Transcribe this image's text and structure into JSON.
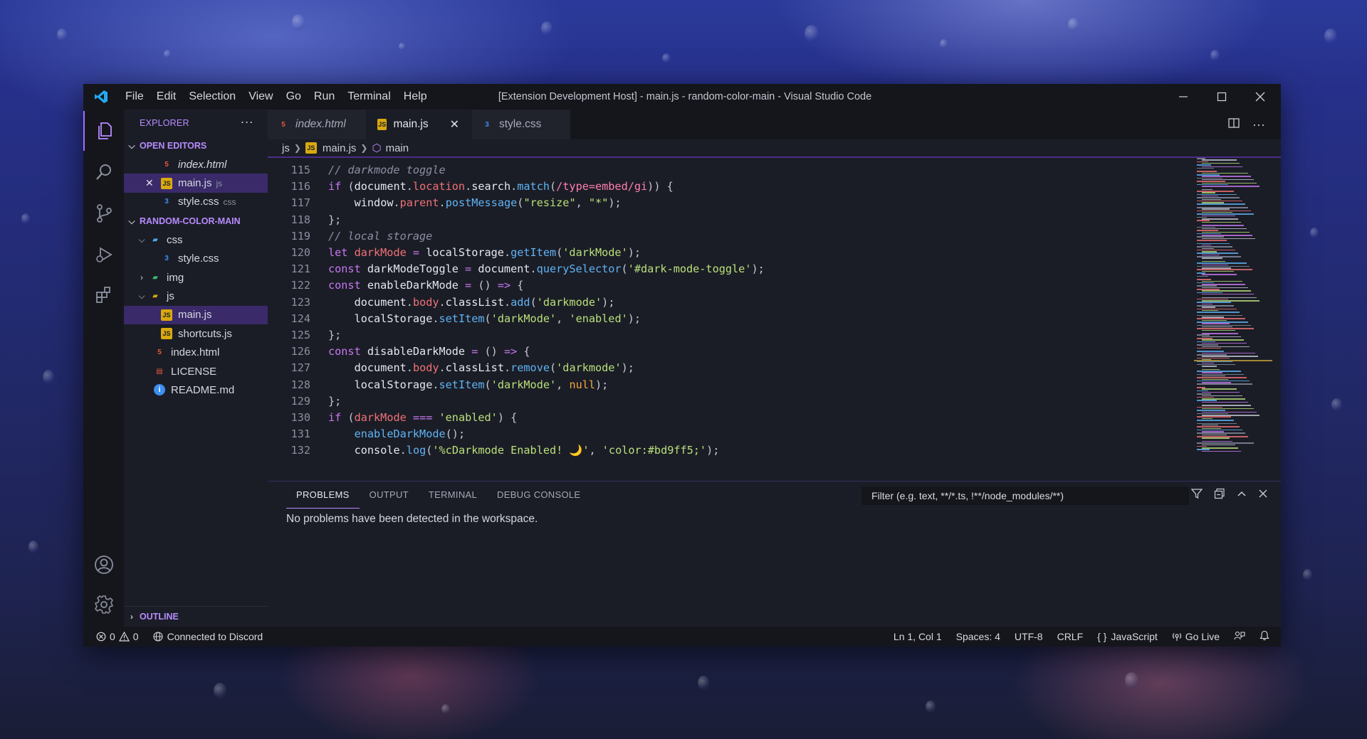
{
  "window": {
    "title": "[Extension Development Host] - main.js - random-color-main - Visual Studio Code",
    "menu": [
      "File",
      "Edit",
      "Selection",
      "View",
      "Go",
      "Run",
      "Terminal",
      "Help"
    ]
  },
  "sidebar": {
    "title": "EXPLORER",
    "open_editors_label": "OPEN EDITORS",
    "open_editors": [
      {
        "name": "index.html",
        "type": "html"
      },
      {
        "name": "main.js",
        "type": "js",
        "suffix": "js"
      },
      {
        "name": "style.css",
        "type": "css",
        "suffix": "css"
      }
    ],
    "project_label": "RANDOM-COLOR-MAIN",
    "tree": {
      "css_folder": "css",
      "style_css": "style.css",
      "img_folder": "img",
      "js_folder": "js",
      "main_js": "main.js",
      "shortcuts_js": "shortcuts.js",
      "index_html": "index.html",
      "license": "LICENSE",
      "readme": "README.md"
    },
    "outline_label": "OUTLINE"
  },
  "tabs": [
    {
      "label": "index.html",
      "type": "html"
    },
    {
      "label": "main.js",
      "type": "js"
    },
    {
      "label": "style.css",
      "type": "css"
    }
  ],
  "breadcrumb": {
    "folder": "js",
    "file": "main.js",
    "symbol": "main"
  },
  "code": {
    "lines": [
      {
        "n": "115",
        "text": "// darkmode toggle"
      },
      {
        "n": "116",
        "text": "if (document.location.search.match(/type=embed/gi)) {"
      },
      {
        "n": "117",
        "text": "    window.parent.postMessage(\"resize\", \"*\");"
      },
      {
        "n": "118",
        "text": "};"
      },
      {
        "n": "119",
        "text": "// local storage"
      },
      {
        "n": "120",
        "text": "let darkMode = localStorage.getItem('darkMode');"
      },
      {
        "n": "121",
        "text": "const darkModeToggle = document.querySelector('#dark-mode-toggle');"
      },
      {
        "n": "122",
        "text": "const enableDarkMode = () => {"
      },
      {
        "n": "123",
        "text": "    document.body.classList.add('darkmode');"
      },
      {
        "n": "124",
        "text": "    localStorage.setItem('darkMode', 'enabled');"
      },
      {
        "n": "125",
        "text": "};"
      },
      {
        "n": "126",
        "text": "const disableDarkMode = () => {"
      },
      {
        "n": "127",
        "text": "    document.body.classList.remove('darkmode');"
      },
      {
        "n": "128",
        "text": "    localStorage.setItem('darkMode', null);"
      },
      {
        "n": "129",
        "text": "};"
      },
      {
        "n": "130",
        "text": "if (darkMode === 'enabled') {"
      },
      {
        "n": "131",
        "text": "    enableDarkMode();"
      },
      {
        "n": "132",
        "text": "    console.log('%cDarkmode Enabled! 🌙', 'color:#bd9ff5;');"
      }
    ]
  },
  "panel": {
    "tabs": [
      "PROBLEMS",
      "OUTPUT",
      "TERMINAL",
      "DEBUG CONSOLE"
    ],
    "filter_placeholder": "Filter (e.g. text, **/*.ts, !**/node_modules/**)",
    "message": "No problems have been detected in the workspace."
  },
  "status": {
    "errors": "0",
    "warnings": "0",
    "discord": "Connected to Discord",
    "position": "Ln 1, Col 1",
    "spaces": "Spaces: 4",
    "encoding": "UTF-8",
    "eol": "CRLF",
    "language": "JavaScript",
    "golive": "Go Live"
  },
  "colors": {
    "accent": "#b68cff",
    "selection": "#3a2a6a",
    "vscode_blue": "#23a9f2"
  }
}
